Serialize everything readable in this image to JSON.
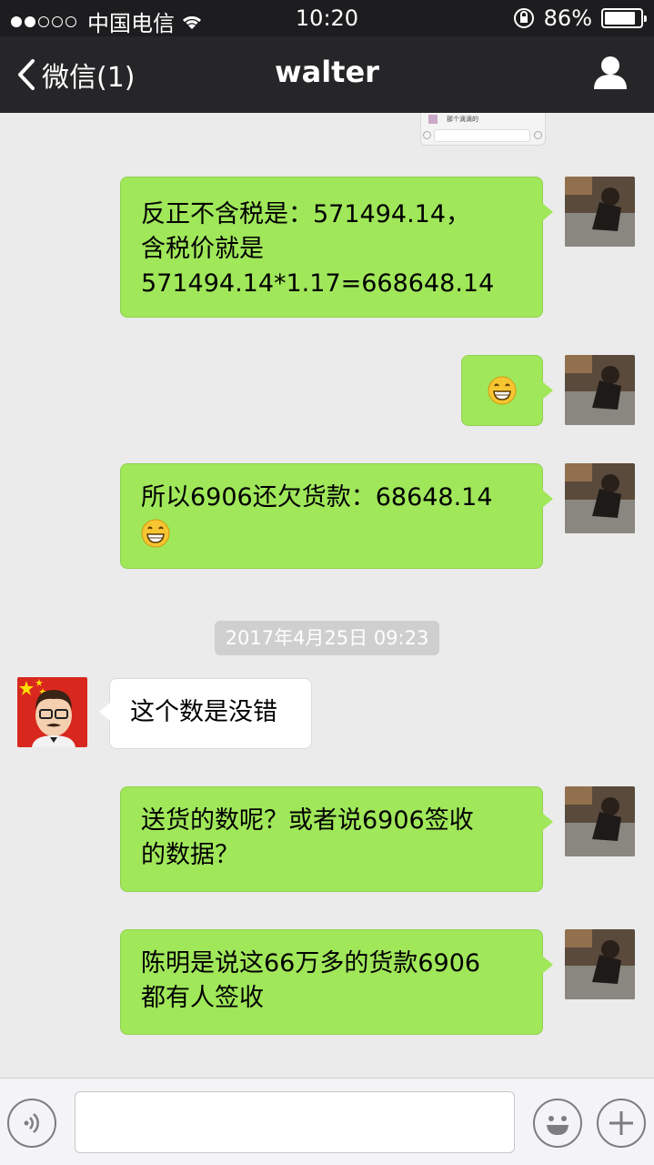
{
  "status_bar": {
    "carrier": "中国电信",
    "time": "10:20",
    "battery": "86%",
    "battery_level": 0.86,
    "signal_bars": 2
  },
  "nav": {
    "back_label": "微信(1)",
    "title": "walter"
  },
  "input": {
    "placeholder": ""
  },
  "messages": [
    {
      "sender": "me",
      "text": "反正不含税是：571494.14，\n含税价就是\n571494.14*1.17=668648.14"
    },
    {
      "sender": "me",
      "text": "",
      "emoji": "grin-emoji"
    },
    {
      "sender": "me",
      "text": "所以6906还欠货款：68648.14",
      "emoji": "grin-emoji"
    },
    {
      "sender": "other",
      "text": "这个数是没错"
    },
    {
      "sender": "me",
      "text": "送货的数呢？或者说6906签收\n的数据？"
    },
    {
      "sender": "me",
      "text": "陈明是说这66万多的货款6906\n都有人签收"
    }
  ],
  "timestamp": "2017年4月25日 09:23",
  "thumbnail_text": "那个滴滴的"
}
